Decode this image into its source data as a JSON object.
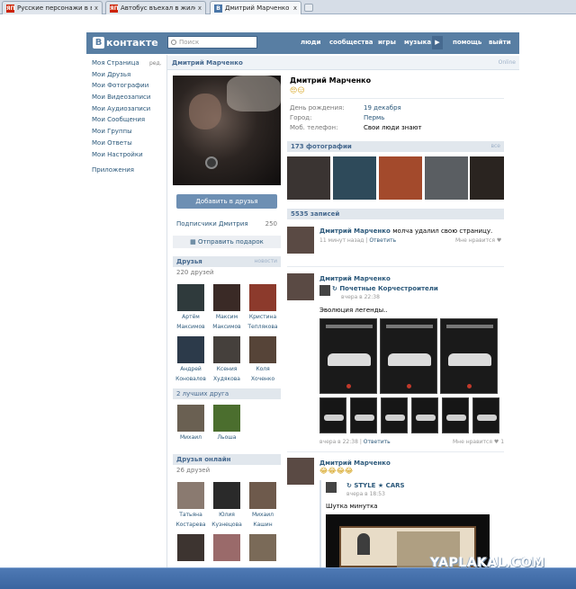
{
  "browser": {
    "tabs": [
      {
        "favicon": "ЯП",
        "title": "Русские персонажи в вк",
        "close": "x"
      },
      {
        "favicon": "ЯП",
        "title": "Автобус въехал в жилой",
        "close": "x"
      },
      {
        "favicon": "В",
        "title": "Дмитрий Марченко",
        "close": "x"
      }
    ]
  },
  "header": {
    "logo": "контакте",
    "logo_letter": "В",
    "search_placeholder": "Поиск",
    "nav": [
      "люди",
      "сообщества",
      "игры",
      "музыка",
      "помощь",
      "выйти"
    ],
    "nav_arrow": "▶"
  },
  "left_menu": {
    "items": [
      "Моя Страница",
      "Мои Друзья",
      "Мои Фотографии",
      "Мои Видеозаписи",
      "Мои Аудиозаписи",
      "Мои Сообщения",
      "Мои Группы",
      "Мои Ответы",
      "Мои Настройки"
    ],
    "edit": "ред.",
    "apps": "Приложения"
  },
  "profile": {
    "header_name": "Дмитрий Марченко",
    "online": "Online",
    "add_friend": "Добавить в друзья",
    "subscribers_label": "Подписчики Дмитрия",
    "subscribers_count": "250",
    "gift": "Отправить подарок",
    "friends_block": "Друзья",
    "friends_news": "новости",
    "friends_count": "220 друзей",
    "friends": [
      {
        "first": "Артём",
        "last": "Максимов"
      },
      {
        "first": "Максим",
        "last": "Максимов"
      },
      {
        "first": "Кристина",
        "last": "Теплякова"
      },
      {
        "first": "Андрей",
        "last": "Коновалов"
      },
      {
        "first": "Ксения",
        "last": "Худякова"
      },
      {
        "first": "Коля",
        "last": "Хоченко"
      }
    ],
    "best_friends_count": "2 лучших друга",
    "best_friends": [
      {
        "first": "Михаил"
      },
      {
        "first": "Льоша"
      }
    ],
    "online_block": "Друзья онлайн",
    "online_count": "26 друзей",
    "online_friends": [
      {
        "first": "Татьяна",
        "last": "Костарева"
      },
      {
        "first": "Юлия",
        "last": "Кузнецова"
      },
      {
        "first": "Михаил",
        "last": "Кашин"
      }
    ],
    "name": "Дмитрий Марченко",
    "status_emoji": "😔😑",
    "info": [
      {
        "k": "День рождения:",
        "v": "19 декабря"
      },
      {
        "k": "Город:",
        "v": "Пермь"
      },
      {
        "k": "Моб. телефон:",
        "v": "Свои люди знают"
      }
    ],
    "photos_block": "173 фотографии",
    "photos_all": "все",
    "posts_block": "5535 записей"
  },
  "posts": [
    {
      "author": "Дмитрий Марченко",
      "text": "молча удалил свою страницу.",
      "time": "11 минут назад",
      "reply": "Ответить",
      "like": "Мне нравится"
    },
    {
      "author": "Дмитрий Марченко",
      "repost_from": "Почетные Корчестроители",
      "repost_time": "вчера в 22:38",
      "text": "Эволюция легенды..",
      "time": "вчера в 22:38",
      "reply": "Ответить",
      "like": "Мне нравится",
      "like_count": "1"
    },
    {
      "author": "Дмитрий Марченко",
      "emoji": "😂😂😂😂",
      "repost_from": "STYLE ★ CARS",
      "repost_time": "вчера в 18:53",
      "text": "Шутка минутка"
    }
  ],
  "watermark": "YAPLAKAL.COM"
}
